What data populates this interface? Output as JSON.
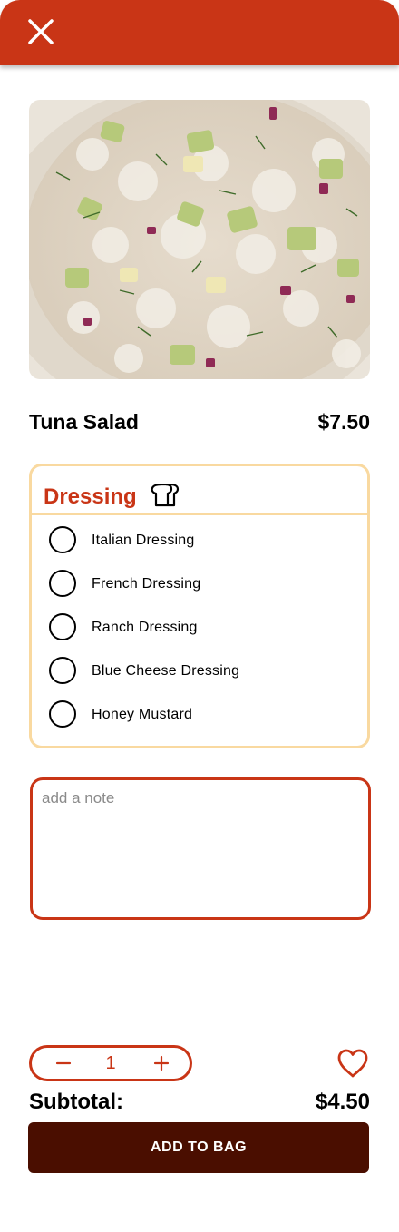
{
  "header": {
    "close_icon": "close-icon",
    "color": "#c93516"
  },
  "item": {
    "name": "Tuna Salad",
    "price": "$7.50",
    "image": "tuna salad bowl photo"
  },
  "dressing": {
    "title": "Dressing",
    "icon": "bread-icon",
    "border_color": "#f9d9a0",
    "options": [
      {
        "label": "Italian Dressing",
        "selected": false
      },
      {
        "label": "French Dressing",
        "selected": false
      },
      {
        "label": "Ranch Dressing",
        "selected": false
      },
      {
        "label": "Blue Cheese Dressing",
        "selected": false
      },
      {
        "label": "Honey Mustard",
        "selected": false
      }
    ]
  },
  "note": {
    "placeholder": "add a note",
    "value": ""
  },
  "quantity": {
    "value": "1",
    "minus_icon": "minus-icon",
    "plus_icon": "plus-icon"
  },
  "favorite": {
    "icon": "heart-icon"
  },
  "subtotal": {
    "label": "Subtotal:",
    "value": "$4.50"
  },
  "cta": {
    "label": "ADD TO BAG",
    "color": "#4a0e00"
  },
  "colors": {
    "accent": "#c93516",
    "dark": "#4a0e00",
    "highlight": "#f9d9a0"
  }
}
